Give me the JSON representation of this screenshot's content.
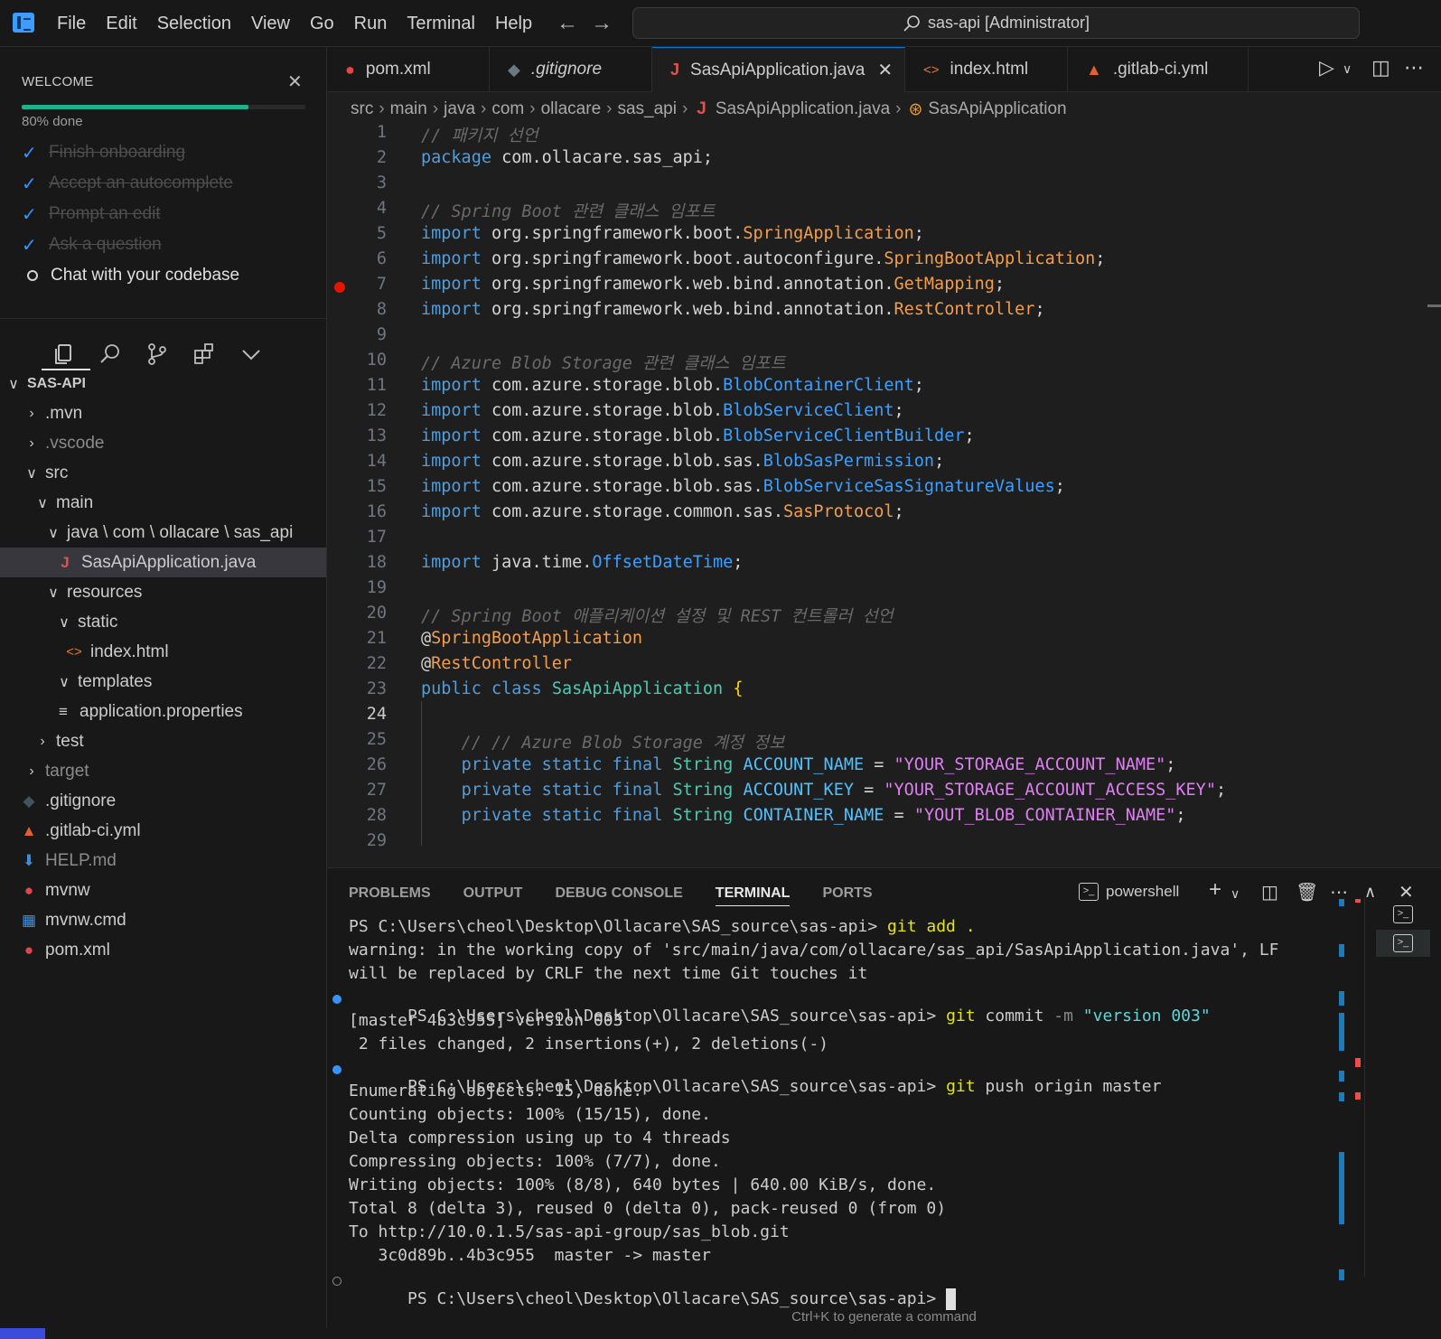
{
  "titlebar": {
    "menu": [
      "File",
      "Edit",
      "Selection",
      "View",
      "Go",
      "Run",
      "Terminal",
      "Help"
    ],
    "command_center": "sas-api [Administrator]"
  },
  "welcome": {
    "title": "WELCOME",
    "progress_text": "80% done",
    "progress": 0.8,
    "done_items": [
      "Finish onboarding",
      "Accept an autocomplete",
      "Prompt an edit",
      "Ask a question"
    ],
    "todo_item": "Chat with your codebase"
  },
  "explorer": {
    "root": "SAS-API",
    "items": [
      {
        "label": ".mvn"
      },
      {
        "label": ".vscode"
      },
      {
        "label": "src"
      },
      {
        "label": "main"
      },
      {
        "label": "java \\ com \\ ollacare \\ sas_api"
      },
      {
        "label": "SasApiApplication.java"
      },
      {
        "label": "resources"
      },
      {
        "label": "static"
      },
      {
        "label": "index.html"
      },
      {
        "label": "templates"
      },
      {
        "label": "application.properties"
      },
      {
        "label": "test"
      },
      {
        "label": "target"
      },
      {
        "label": ".gitignore"
      },
      {
        "label": ".gitlab-ci.yml"
      },
      {
        "label": "HELP.md"
      },
      {
        "label": "mvnw"
      },
      {
        "label": "mvnw.cmd"
      },
      {
        "label": "pom.xml"
      }
    ]
  },
  "tabs": [
    {
      "label": "pom.xml"
    },
    {
      "label": ".gitignore"
    },
    {
      "label": "SasApiApplication.java"
    },
    {
      "label": "index.html"
    },
    {
      "label": ".gitlab-ci.yml"
    }
  ],
  "breadcrumb": [
    "src",
    "main",
    "java",
    "com",
    "ollacare",
    "sas_api",
    "SasApiApplication.java",
    "SasApiApplication"
  ],
  "code": {
    "current_line": 24,
    "lines": [
      "// 패키지 선언",
      "package com.ollacare.sas_api;",
      "",
      "// Spring Boot 관련 클래스 임포트",
      "import org.springframework.boot.SpringApplication;",
      "import org.springframework.boot.autoconfigure.SpringBootApplication;",
      "import org.springframework.web.bind.annotation.GetMapping;",
      "import org.springframework.web.bind.annotation.RestController;",
      "",
      "// Azure Blob Storage 관련 클래스 임포트",
      "import com.azure.storage.blob.BlobContainerClient;",
      "import com.azure.storage.blob.BlobServiceClient;",
      "import com.azure.storage.blob.BlobServiceClientBuilder;",
      "import com.azure.storage.blob.sas.BlobSasPermission;",
      "import com.azure.storage.blob.sas.BlobServiceSasSignatureValues;",
      "import com.azure.storage.common.sas.SasProtocol;",
      "",
      "import java.time.OffsetDateTime;",
      "",
      "// Spring Boot 애플리케이션 설정 및 REST 컨트롤러 선언",
      "@SpringBootApplication",
      "@RestController",
      "public class SasApiApplication {",
      "",
      "    // // Azure Blob Storage 계정 정보",
      "    private static final String ACCOUNT_NAME = \"YOUR_STORAGE_ACCOUNT_NAME\";",
      "    private static final String ACCOUNT_KEY = \"YOUR_STORAGE_ACCOUNT_ACCESS_KEY\";",
      "    private static final String CONTAINER_NAME = \"YOUT_BLOB_CONTAINER_NAME\";",
      ""
    ]
  },
  "panel": {
    "tabs": [
      "PROBLEMS",
      "OUTPUT",
      "DEBUG CONSOLE",
      "TERMINAL",
      "PORTS"
    ],
    "shell": "powershell",
    "hint": "Ctrl+K to generate a command",
    "terminal": {
      "prompt": "PS C:\\Users\\cheol\\Desktop\\Ollacare\\SAS_source\\sas-api> ",
      "cmd1": "git add .",
      "out1a": "warning: in the working copy of 'src/main/java/com/ollacare/sas_api/SasApiApplication.java', LF",
      "out1b": "will be replaced by CRLF the next time Git touches it",
      "cmd2_git": "git",
      "cmd2_sub": " commit ",
      "cmd2_flag": "-m",
      "cmd2_msg": " \"version 003\"",
      "out2a": "[master 4b3c955] version 003",
      "out2b": " 2 files changed, 2 insertions(+), 2 deletions(-)",
      "cmd3_git": "git",
      "cmd3_rest": " push origin master",
      "out3": [
        "Enumerating objects: 15, done.",
        "Counting objects: 100% (15/15), done.",
        "Delta compression using up to 4 threads",
        "Compressing objects: 100% (7/7), done.",
        "Writing objects: 100% (8/8), 640 bytes | 640.00 KiB/s, done.",
        "Total 8 (delta 3), reused 0 (delta 0), pack-reused 0 (from 0)",
        "To http://10.0.1.5/sas-api-group/sas_blob.git",
        "   3c0d89b..4b3c955  master -> master"
      ]
    }
  }
}
